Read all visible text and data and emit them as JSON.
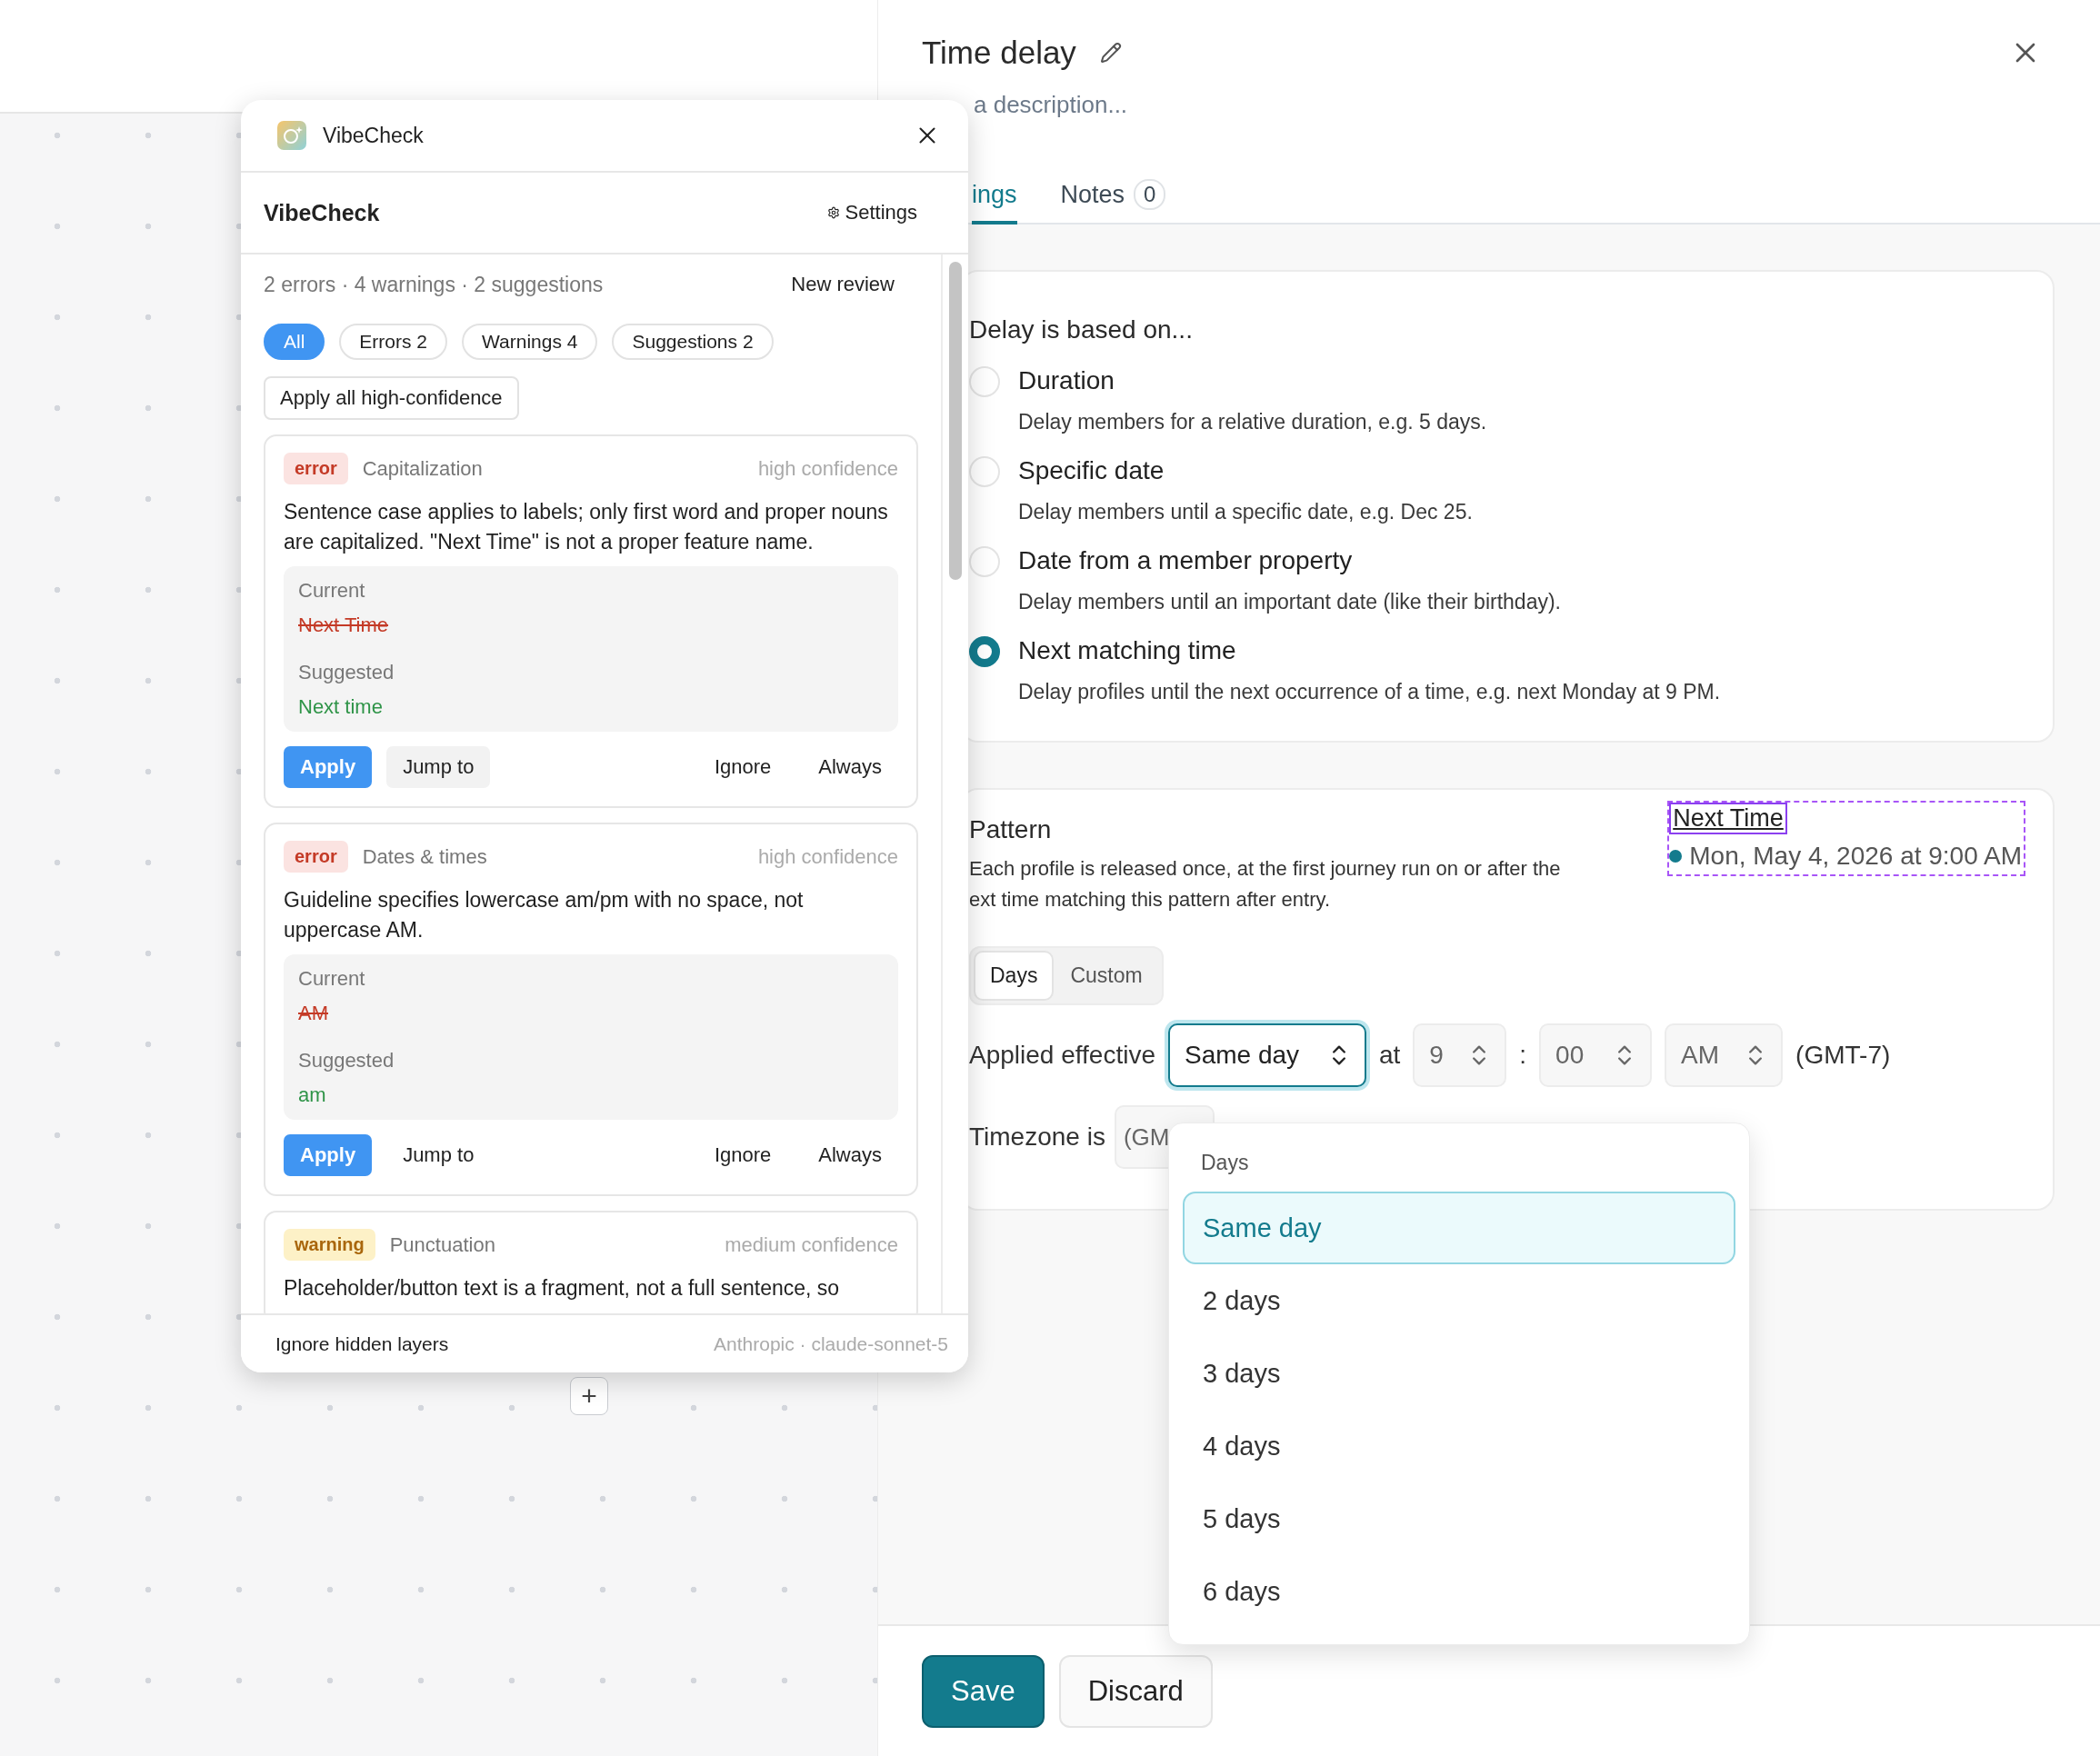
{
  "canvas": {
    "add_button": "+"
  },
  "drawer": {
    "title": "Time delay",
    "description_placeholder": "a description...",
    "tabs": [
      {
        "label": "ings",
        "selected": true
      },
      {
        "label": "Notes",
        "count": "0",
        "selected": false
      }
    ],
    "delay": {
      "heading": "Delay is based on...",
      "options": [
        {
          "label": "Duration",
          "description": "Delay members for a relative duration, e.g. 5 days.",
          "selected": false
        },
        {
          "label": "Specific date",
          "description": "Delay members until a specific date, e.g. Dec 25.",
          "selected": false
        },
        {
          "label": "Date from a member property",
          "description": "Delay members until an important date (like their birthday).",
          "selected": false
        },
        {
          "label": "Next matching time",
          "description": "Delay profiles until the next occurrence of a time, e.g. next Monday at 9 PM.",
          "selected": true
        }
      ]
    },
    "pattern": {
      "heading": "Pattern",
      "description_lines": [
        "Each profile is released once, at the first journey run on or after the",
        "ext time matching this pattern after entry."
      ],
      "next_time": {
        "label": "Next Time",
        "value": "Mon, May 4, 2026 at 9:00 AM"
      },
      "modes": [
        {
          "label": "Days",
          "selected": true
        },
        {
          "label": "Custom",
          "selected": false
        }
      ],
      "schedule": {
        "label": "Applied effective",
        "day": "Same day",
        "at": "at",
        "hour": "9",
        "separator": ":",
        "minute": "00",
        "meridiem": "AM",
        "offset": "(GMT-7)"
      },
      "timezone": {
        "label": "Timezone is",
        "value": "(GM"
      }
    },
    "dropdown": {
      "group": "Days",
      "options": [
        {
          "label": "Same day",
          "selected": true
        },
        {
          "label": "2 days",
          "selected": false
        },
        {
          "label": "3 days",
          "selected": false
        },
        {
          "label": "4 days",
          "selected": false
        },
        {
          "label": "5 days",
          "selected": false
        },
        {
          "label": "6 days",
          "selected": false
        }
      ]
    },
    "footer": {
      "save": "Save",
      "discard": "Discard"
    }
  },
  "plugin": {
    "title": "VibeCheck",
    "heading": "VibeCheck",
    "settings": "Settings",
    "summary": "2 errors · 4 warnings · 2 suggestions",
    "new_review": "New review",
    "filters": [
      {
        "label": "All",
        "selected": true
      },
      {
        "label": "Errors 2",
        "selected": false
      },
      {
        "label": "Warnings 4",
        "selected": false
      },
      {
        "label": "Suggestions 2",
        "selected": false
      }
    ],
    "apply_all": "Apply all high-confidence",
    "issues": [
      {
        "kind": "error",
        "badge": "error",
        "category": "Capitalization",
        "confidence": "high confidence",
        "message": "Sentence case applies to labels; only first word and proper nouns are capitalized. \"Next Time\" is not a proper feature name.",
        "current_label": "Current",
        "current": "Next Time",
        "suggested_label": "Suggested",
        "suggested": "Next time",
        "actions": [
          {
            "label": "Apply",
            "kind": "primary"
          },
          {
            "label": "Jump to",
            "kind": "plain",
            "hovered": true
          },
          {
            "label": "Ignore",
            "kind": "plain",
            "hovered": false
          },
          {
            "label": "Always",
            "kind": "plain",
            "hovered": false
          }
        ]
      },
      {
        "kind": "error",
        "badge": "error",
        "category": "Dates & times",
        "confidence": "high confidence",
        "message": "Guideline specifies lowercase am/pm with no space, not uppercase AM.",
        "current_label": "Current",
        "current": "AM",
        "suggested_label": "Suggested",
        "suggested": "am",
        "actions": [
          {
            "label": "Apply",
            "kind": "primary"
          },
          {
            "label": "Jump to",
            "kind": "plain",
            "hovered": false
          },
          {
            "label": "Ignore",
            "kind": "plain",
            "hovered": false
          },
          {
            "label": "Always",
            "kind": "plain",
            "hovered": false
          }
        ]
      },
      {
        "kind": "warning",
        "badge": "warning",
        "category": "Punctuation",
        "confidence": "medium confidence",
        "message": "Placeholder/button text is a fragment, not a full sentence, so"
      }
    ],
    "footer": {
      "toggle": "Ignore hidden layers",
      "model": "Anthropic · claude-sonnet-5"
    }
  }
}
